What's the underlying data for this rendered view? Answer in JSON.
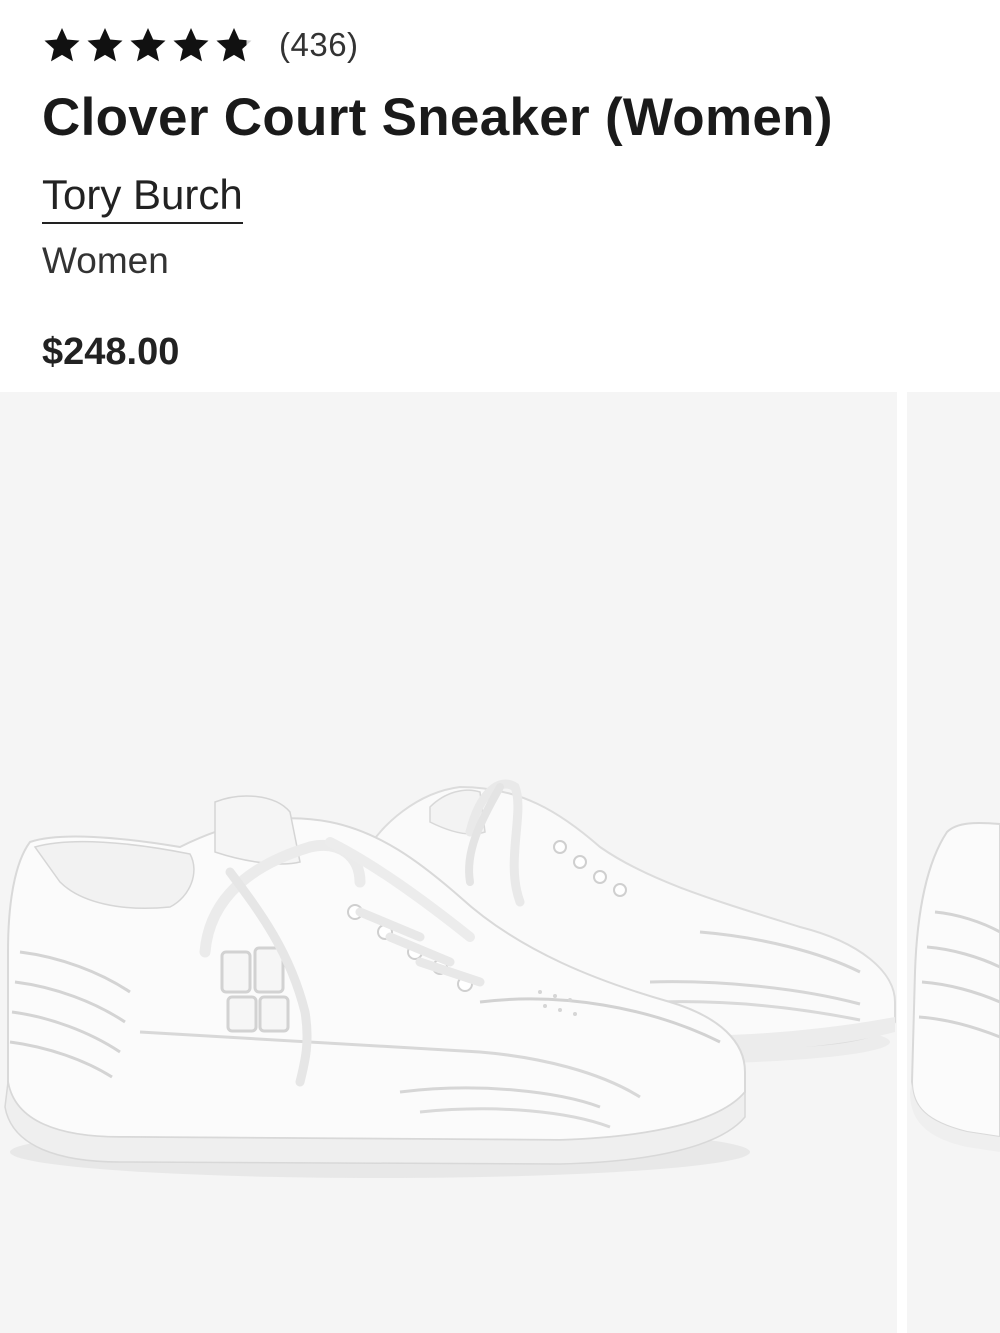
{
  "product": {
    "rating": {
      "stars_filled": 4.8,
      "stars_total": 5,
      "review_count": "(436)",
      "star_color": "#111111"
    },
    "title": "Clover Court Sneaker (Women)",
    "brand": "Tory Burch",
    "category": "Women",
    "price": "$248.00"
  },
  "gallery": {
    "images": [
      {
        "alt": "white-leather-sneaker-pair"
      },
      {
        "alt": "white-leather-sneaker-partial"
      }
    ]
  }
}
